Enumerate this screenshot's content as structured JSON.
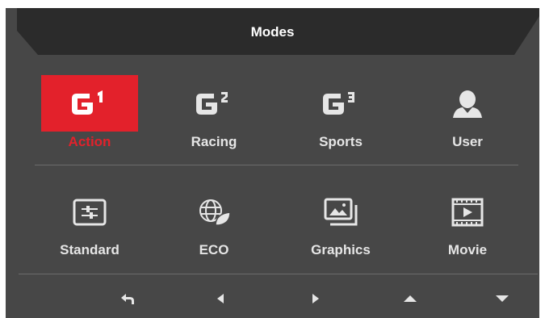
{
  "header": {
    "title": "Modes"
  },
  "modes_row1": [
    {
      "label": "Action",
      "icon": "g1-icon",
      "selected": true
    },
    {
      "label": "Racing",
      "icon": "g2-icon",
      "selected": false
    },
    {
      "label": "Sports",
      "icon": "g3-icon",
      "selected": false
    },
    {
      "label": "User",
      "icon": "user-icon",
      "selected": false
    }
  ],
  "modes_row2": [
    {
      "label": "Standard",
      "icon": "sliders-icon"
    },
    {
      "label": "ECO",
      "icon": "eco-globe-icon"
    },
    {
      "label": "Graphics",
      "icon": "picture-icon"
    },
    {
      "label": "Movie",
      "icon": "film-icon"
    }
  ],
  "nav": [
    "back-icon",
    "left-arrow-icon",
    "right-arrow-icon",
    "up-arrow-icon",
    "down-arrow-icon"
  ],
  "colors": {
    "accent": "#e3212b",
    "panel": "#474747",
    "header": "#2b2b2b",
    "text": "#e6e6e6"
  }
}
